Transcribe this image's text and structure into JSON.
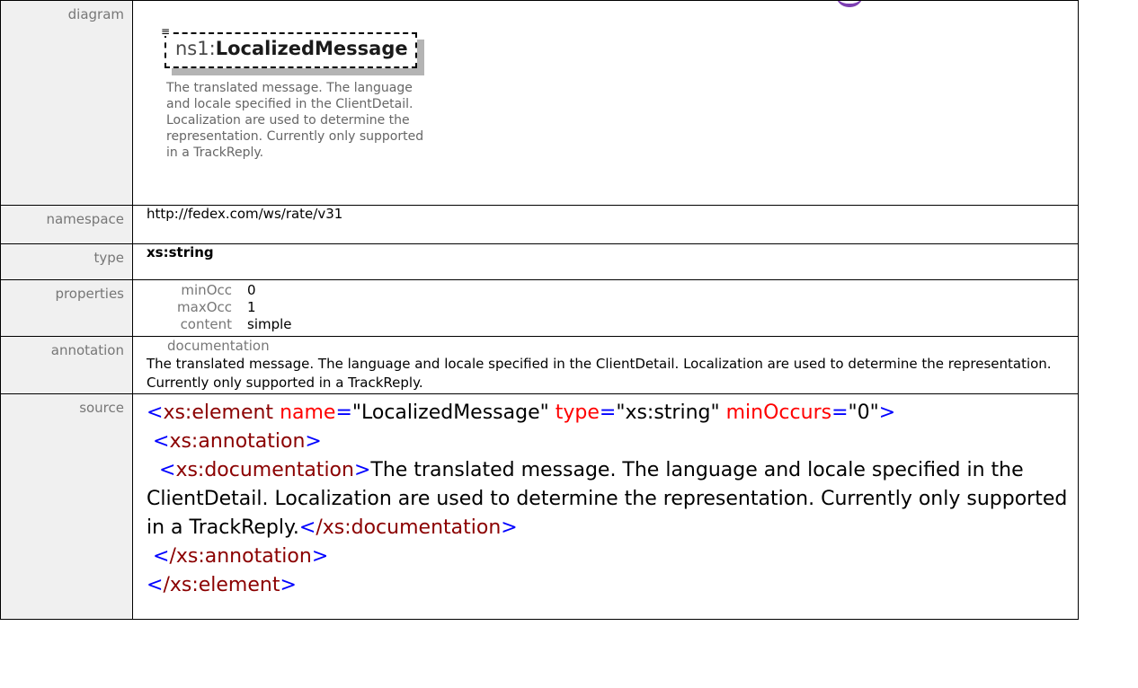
{
  "diagram": {
    "label": "diagram",
    "element_prefix": "ns1:",
    "element_name": "LocalizedMessage",
    "doc_text": "The translated message. The language and locale specified in the ClientDetail. Localization are used to determine the representation. Currently only supported in a TrackReply."
  },
  "namespace": {
    "label": "namespace",
    "value": "http://fedex.com/ws/rate/v31"
  },
  "type": {
    "label": "type",
    "value": "xs:string"
  },
  "properties": {
    "label": "properties",
    "items": [
      {
        "key": "minOcc",
        "value": "0"
      },
      {
        "key": "maxOcc",
        "value": "1"
      },
      {
        "key": "content",
        "value": "simple"
      }
    ]
  },
  "annotation": {
    "label": "annotation",
    "key": "documentation",
    "value": "The translated message. The language and locale specified in the ClientDetail. Localization are used to determine the representation. Currently only supported in a TrackReply."
  },
  "source": {
    "label": "source",
    "open_tag": "xs:element",
    "attr1_name": "name",
    "attr1_value": "\"LocalizedMessage\"",
    "attr2_name": "type",
    "attr2_value": "\"xs:string\"",
    "attr3_name": "minOccurs",
    "attr3_value": "\"0\"",
    "annotation_tag": "xs:annotation",
    "documentation_tag": "xs:documentation",
    "documentation_text": "The translated message. The language and locale specified in the ClientDetail. Localization are used to determine the representation. Currently only supported in a TrackReply.",
    "close_documentation_tag": "/xs:documentation",
    "close_annotation_tag": "/xs:annotation",
    "close_element_tag": "/xs:element"
  },
  "colors": {
    "tag": "#8b0000",
    "punct": "#0000ff",
    "attr": "#ff0000",
    "label_bg": "#f0f0f0",
    "title_accent": "#7e3fb3"
  }
}
